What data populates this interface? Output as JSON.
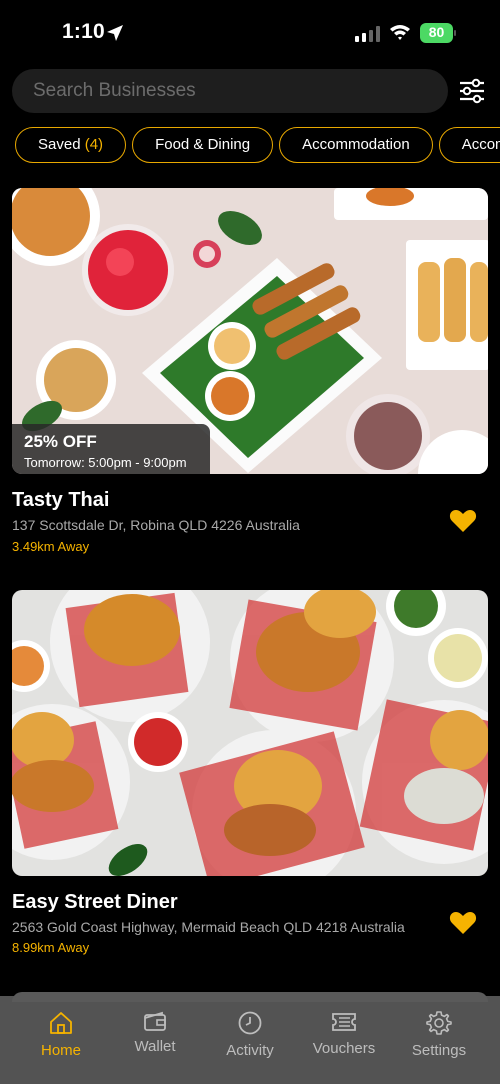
{
  "status_bar": {
    "time": "1:10",
    "battery": "80"
  },
  "search": {
    "placeholder": "Search Businesses"
  },
  "chips": {
    "saved_label": "Saved",
    "saved_count": "(4)",
    "items": [
      "Food & Dining",
      "Accommodation",
      "Accommodation"
    ]
  },
  "listings": [
    {
      "name": "Tasty Thai",
      "address": "137 Scottsdale Dr, Robina QLD 4226 Australia",
      "distance": "3.49km Away",
      "offer": {
        "title": "25% OFF",
        "time": "Tomorrow: 5:00pm - 9:00pm"
      },
      "saved": true
    },
    {
      "name": "Easy Street Diner",
      "address": "2563 Gold Coast Highway, Mermaid Beach QLD 4218 Australia",
      "distance": "8.99km Away",
      "saved": true
    }
  ],
  "tabs": [
    {
      "label": "Home",
      "icon": "home-icon",
      "active": true
    },
    {
      "label": "Wallet",
      "icon": "wallet-icon",
      "active": false
    },
    {
      "label": "Activity",
      "icon": "clock-icon",
      "active": false
    },
    {
      "label": "Vouchers",
      "icon": "voucher-icon",
      "active": false
    },
    {
      "label": "Settings",
      "icon": "gear-icon",
      "active": false
    }
  ],
  "colors": {
    "accent": "#f5b301",
    "background": "#000000",
    "tab_bar": "#5a5a5a"
  }
}
